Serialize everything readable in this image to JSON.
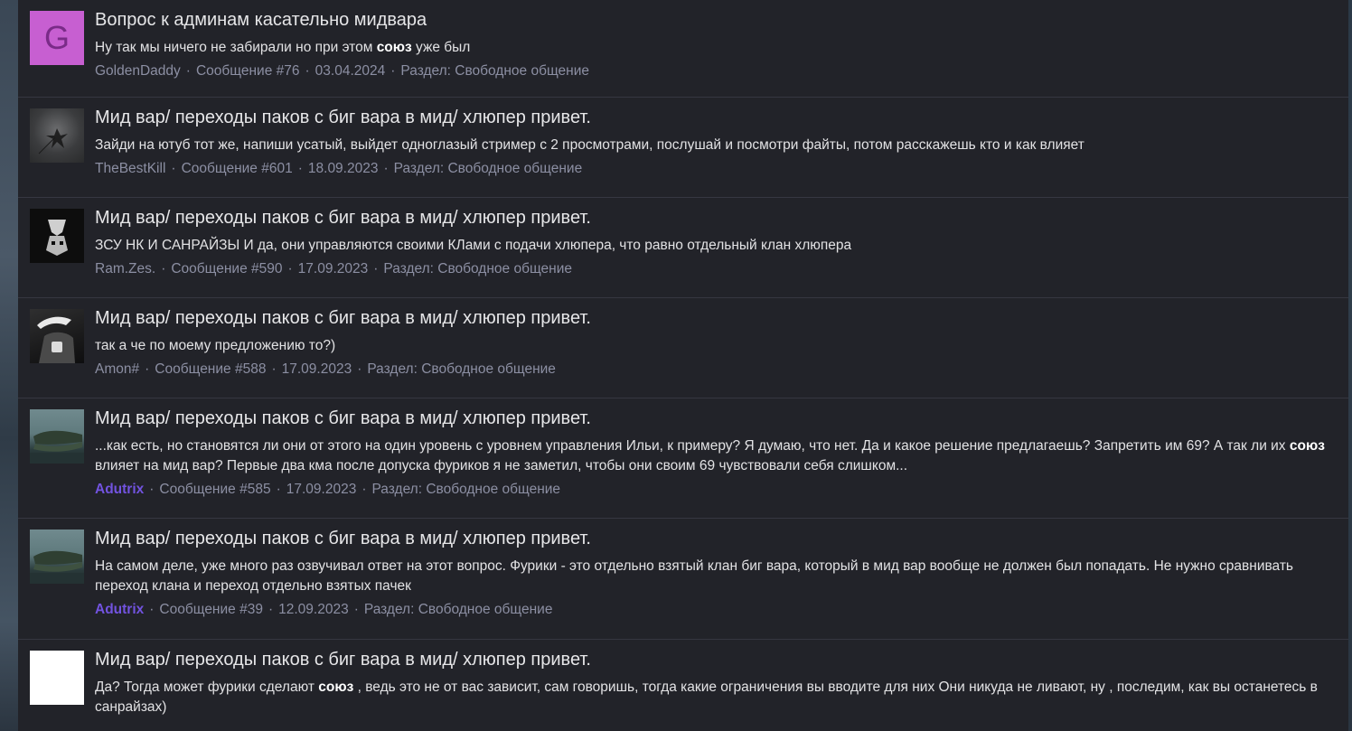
{
  "results": [
    {
      "avatar": {
        "type": "letter",
        "letter": "G"
      },
      "title": "Вопрос к админам касательно мидвара",
      "snippet": [
        {
          "text": "Ну так мы ничего не забирали но при этом ",
          "bold": false
        },
        {
          "text": "союз",
          "bold": true
        },
        {
          "text": " уже был",
          "bold": false
        }
      ],
      "user": "GoldenDaddy",
      "user_highlight": false,
      "message": "Сообщение #76",
      "date": "03.04.2024",
      "section": "Раздел: Свободное общение"
    },
    {
      "avatar": {
        "type": "image",
        "icon": "gray-abstract-avatar-icon"
      },
      "title": "Мид вар/ переходы паков с биг вара в мид/ хлюпер привет.",
      "snippet": [
        {
          "text": "Зайди на ютуб тот же, напиши усатый, выйдет одноглазый стример с 2 просмотрами, послушай и посмотри файты, потом расскажешь кто и как влияет",
          "bold": false
        }
      ],
      "user": "TheBestKill",
      "user_highlight": false,
      "message": "Сообщение #601",
      "date": "18.09.2023",
      "section": "Раздел: Свободное общение"
    },
    {
      "avatar": {
        "type": "image",
        "icon": "dark-mask-avatar-icon"
      },
      "title": "Мид вар/ переходы паков с биг вара в мид/ хлюпер привет.",
      "snippet": [
        {
          "text": "ЗСУ НК И САНРАЙЗЫ И да, они управляются своими КЛами с подачи хлюпера, что равно отдельный клан хлюпера",
          "bold": false
        }
      ],
      "user": "Ram.Zes.",
      "user_highlight": false,
      "message": "Сообщение #590",
      "date": "17.09.2023",
      "section": "Раздел: Свободное общение"
    },
    {
      "avatar": {
        "type": "image",
        "icon": "hand-sign-avatar-icon"
      },
      "title": "Мид вар/ переходы паков с биг вара в мид/ хлюпер привет.",
      "snippet": [
        {
          "text": "так а че по моему предложению то?)",
          "bold": false
        }
      ],
      "user": "Amon#",
      "user_highlight": false,
      "message": "Сообщение #588",
      "date": "17.09.2023",
      "section": "Раздел: Свободное общение"
    },
    {
      "avatar": {
        "type": "image",
        "icon": "crocodile-avatar-icon"
      },
      "title": "Мид вар/ переходы паков с биг вара в мид/ хлюпер привет.",
      "snippet": [
        {
          "text": "...как есть, но становятся ли они от этого на один уровень с уровнем управления Ильи, к примеру? Я думаю, что нет. Да и какое решение предлагаешь? Запретить им 69? А так ли их ",
          "bold": false
        },
        {
          "text": "союз",
          "bold": true
        },
        {
          "text": " влияет на мид вар? Первые два кма после допуска фуриков я не заметил, чтобы они своим 69 чувствовали себя слишком...",
          "bold": false
        }
      ],
      "user": "Adutrix",
      "user_highlight": true,
      "message": "Сообщение #585",
      "date": "17.09.2023",
      "section": "Раздел: Свободное общение"
    },
    {
      "avatar": {
        "type": "image",
        "icon": "crocodile-avatar-icon"
      },
      "title": "Мид вар/ переходы паков с биг вара в мид/ хлюпер привет.",
      "snippet": [
        {
          "text": "На самом деле, уже много раз озвучивал ответ на этот вопрос. Фурики - это отдельно взятый клан биг вара, который в мид вар вообще не должен был попадать. Не нужно сравнивать переход клана и переход отдельно взятых пачек",
          "bold": false
        }
      ],
      "user": "Adutrix",
      "user_highlight": true,
      "message": "Сообщение #39",
      "date": "12.09.2023",
      "section": "Раздел: Свободное общение"
    },
    {
      "avatar": {
        "type": "image",
        "icon": "white-blank-avatar-icon"
      },
      "title": "Мид вар/ переходы паков с биг вара в мид/ хлюпер привет.",
      "snippet": [
        {
          "text": "Да? Тогда может фурики сделают ",
          "bold": false
        },
        {
          "text": "союз",
          "bold": true
        },
        {
          "text": " , ведь это не от вас зависит, сам говоришь, тогда какие ограничения вы вводите для них Они никуда не ливают, ну , последим, как вы останетесь в санрайзах)",
          "bold": false
        }
      ],
      "user": "",
      "user_highlight": false,
      "message": "",
      "date": "",
      "section": ""
    }
  ],
  "colors": {
    "panel_bg": "#222329",
    "divider": "#363741",
    "title": "#e6e6e8",
    "meta": "#8c8fa3",
    "highlight_user": "#7253e0",
    "letter_avatar_bg": "#c75fd1"
  }
}
